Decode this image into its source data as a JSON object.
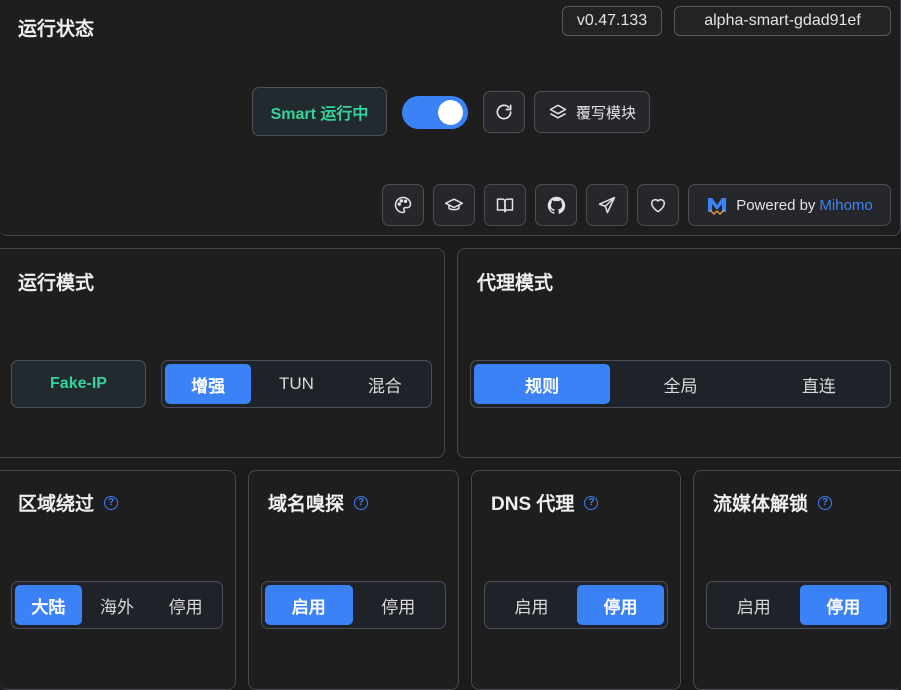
{
  "status": {
    "title": "运行状态",
    "version": "v0.47.133",
    "build": "alpha-smart-gdad91ef",
    "smart_label": "Smart 运行中",
    "enabled": true,
    "override_label": "覆写模块",
    "powered_by": "Powered by",
    "brand": "Mihomo",
    "icons": [
      "palette-icon",
      "graduation-cap-icon",
      "book-icon",
      "github-icon",
      "telegram-icon",
      "heart-icon"
    ]
  },
  "run_mode": {
    "title": "运行模式",
    "fake_ip": "Fake-IP",
    "options": [
      "增强",
      "TUN",
      "混合"
    ],
    "selected": "增强"
  },
  "proxy_mode": {
    "title": "代理模式",
    "options": [
      "规则",
      "全局",
      "直连"
    ],
    "selected": "规则"
  },
  "region_bypass": {
    "title": "区域绕过",
    "options": [
      "大陆",
      "海外",
      "停用"
    ],
    "selected": "大陆"
  },
  "domain_sniff": {
    "title": "域名嗅探",
    "options": [
      "启用",
      "停用"
    ],
    "selected": "启用"
  },
  "dns_proxy": {
    "title": "DNS 代理",
    "options": [
      "启用",
      "停用"
    ],
    "selected": "停用"
  },
  "streaming_unlock": {
    "title": "流媒体解锁",
    "options": [
      "启用",
      "停用"
    ],
    "selected": "停用"
  },
  "colors": {
    "accent": "#3b82f6",
    "running_green": "#34d399",
    "background": "#1b1b1c"
  }
}
